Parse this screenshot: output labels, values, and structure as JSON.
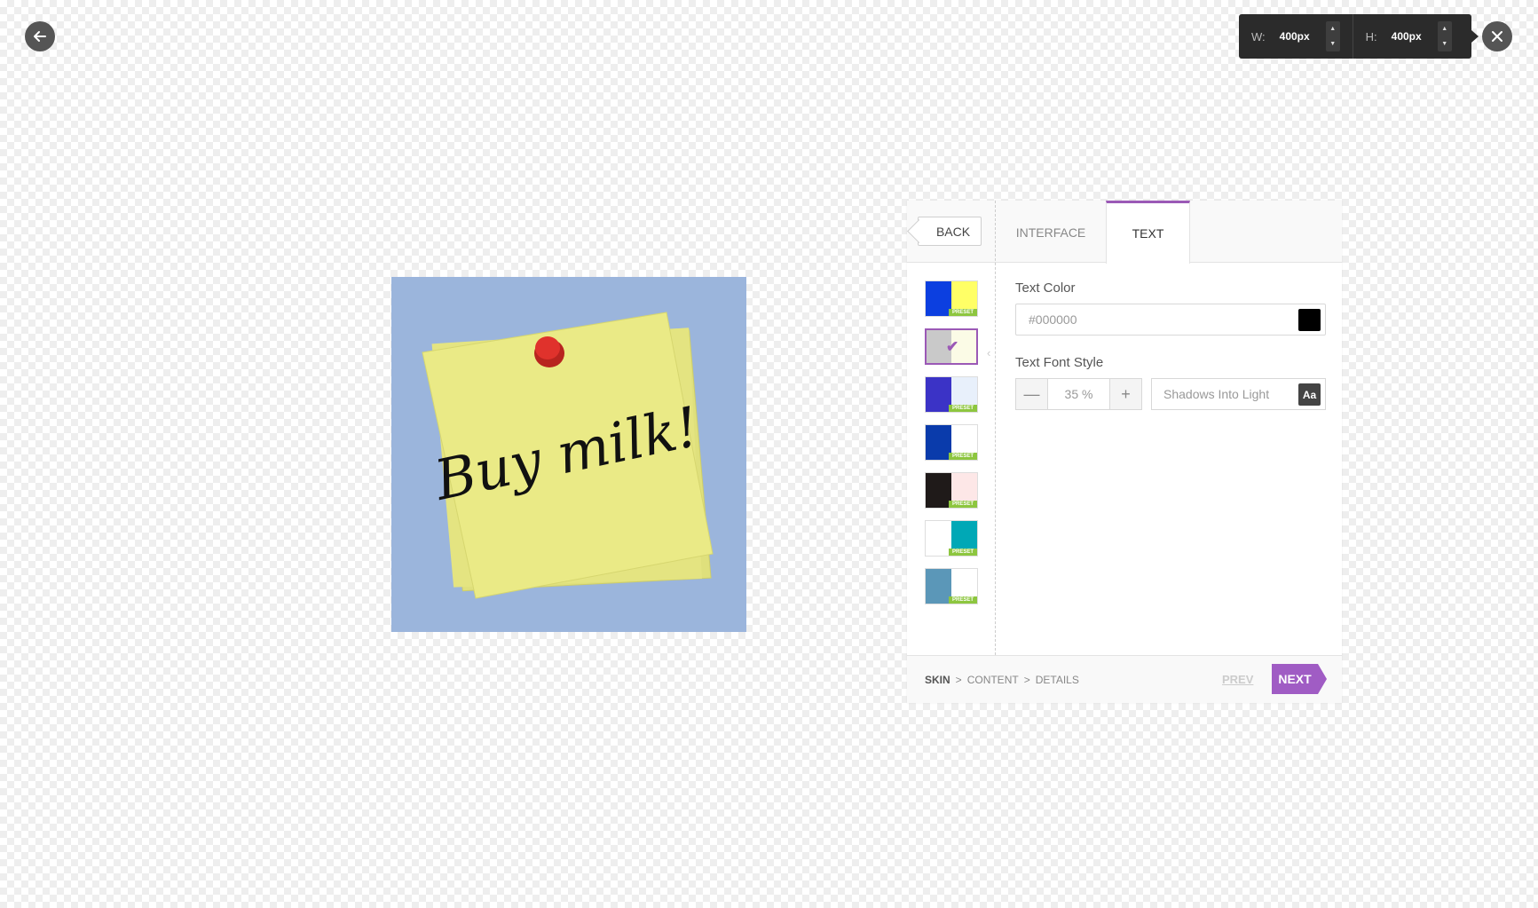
{
  "toolbar": {
    "back_icon": "arrow-left-icon",
    "close_icon": "close-icon",
    "width_label": "W:",
    "width_value": "400px",
    "height_label": "H:",
    "height_value": "400px"
  },
  "canvas": {
    "note_text": "Buy milk!",
    "background_color": "#9bb5dc",
    "note_color": "#eaea86",
    "pin_color": "#e0322c"
  },
  "panel": {
    "back_label": "BACK",
    "tabs": [
      {
        "label": "INTERFACE",
        "active": false
      },
      {
        "label": "TEXT",
        "active": true
      }
    ],
    "swatches": [
      {
        "left": "#0c3fe0",
        "right": "#ffff66",
        "badge": "PRESET",
        "selected": false
      },
      {
        "left": "#c9c9c9",
        "right": "#fbfbe6",
        "badge": "",
        "selected": true
      },
      {
        "left": "#3b33c6",
        "right": "#e8f0fb",
        "badge": "PRESET",
        "selected": false
      },
      {
        "left": "#0a3bab",
        "right": "#ffffff",
        "badge": "PRESET",
        "selected": false
      },
      {
        "left": "#1f1a19",
        "right": "#fde7e7",
        "badge": "PRESET",
        "selected": false
      },
      {
        "left": "#ffffff",
        "right": "#00a8b6",
        "badge": "PRESET",
        "selected": false
      },
      {
        "left": "#5b97b8",
        "right": "#ffffff",
        "badge": "PRESET",
        "selected": false
      }
    ],
    "text_color_label": "Text Color",
    "text_color_value": "#000000",
    "text_color_chip": "#000000",
    "font_style_label": "Text Font Style",
    "font_size_value": "35 %",
    "font_name": "Shadows Into Light",
    "font_icon_label": "Aa"
  },
  "footer": {
    "crumbs": [
      "SKIN",
      "CONTENT",
      "DETAILS"
    ],
    "crumb_sep": ">",
    "prev_label": "PREV",
    "next_label": "NEXT"
  }
}
